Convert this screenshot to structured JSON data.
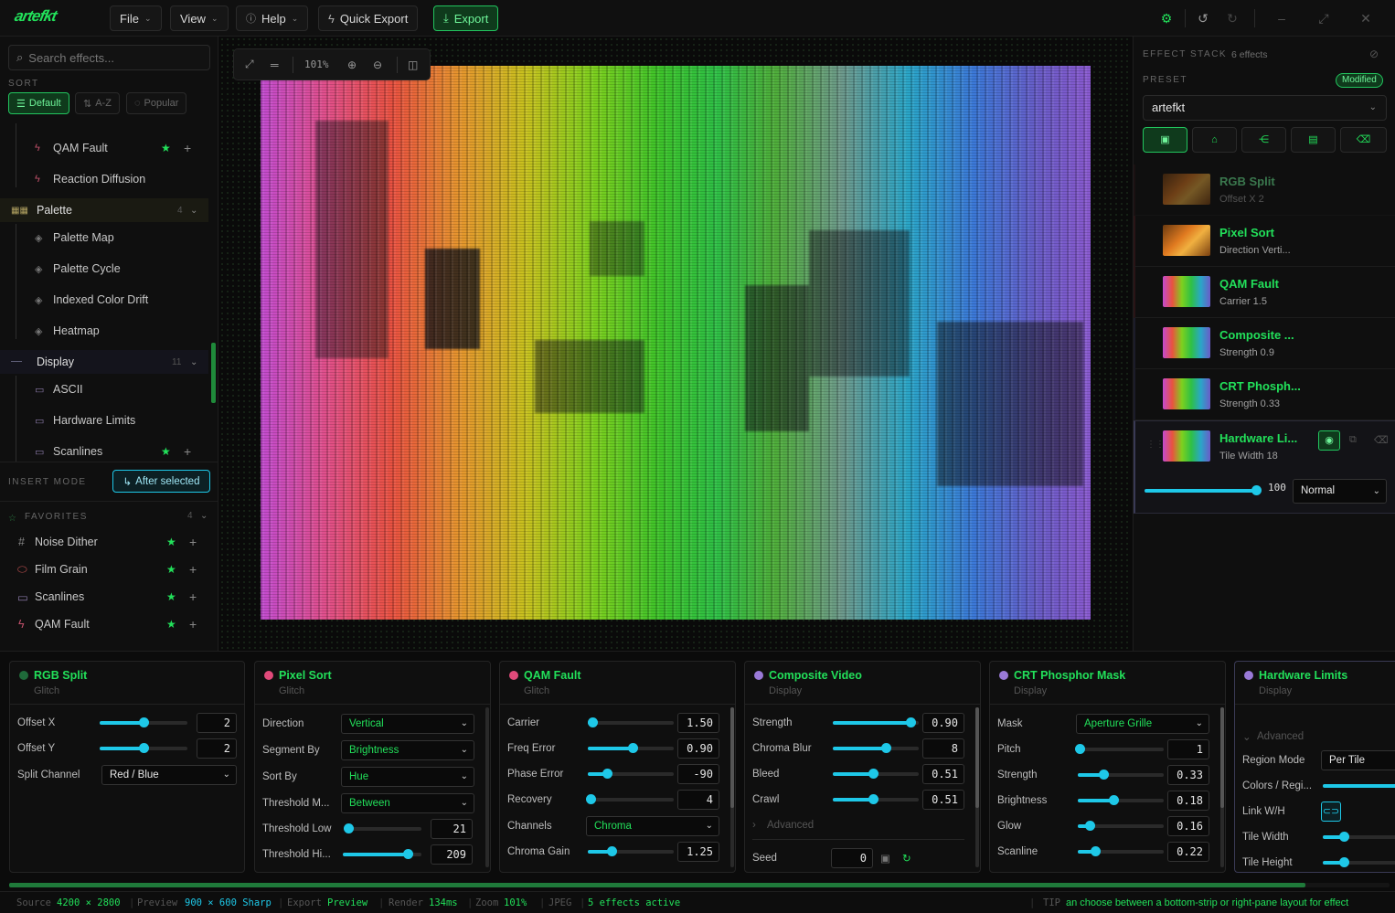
{
  "topbar": {
    "logo": "artefkt",
    "menus": [
      {
        "label": "File"
      },
      {
        "label": "View"
      },
      {
        "label": "Help"
      }
    ],
    "quick_export": "Quick Export",
    "export": "Export"
  },
  "left": {
    "search_placeholder": "Search effects...",
    "sort_label": "SORT",
    "sort_options": [
      "Default",
      "A-Z",
      "Popular"
    ],
    "tree": {
      "glitch_items": [
        "QAM Fault",
        "Reaction Diffusion"
      ],
      "palette": {
        "label": "Palette",
        "count": "4",
        "items": [
          "Palette Map",
          "Palette Cycle",
          "Indexed Color Drift",
          "Heatmap"
        ]
      },
      "display": {
        "label": "Display",
        "count": "11",
        "items": [
          "ASCII",
          "Hardware Limits",
          "Scanlines"
        ]
      }
    },
    "insert_mode_label": "INSERT MODE",
    "insert_mode_value": "After selected",
    "favorites": {
      "label": "FAVORITES",
      "count": "4",
      "items": [
        "Noise Dither",
        "Film Grain",
        "Scanlines",
        "QAM Fault"
      ]
    }
  },
  "canvas": {
    "zoom": "101%"
  },
  "right": {
    "title": "EFFECT STACK",
    "count": "6 effects",
    "preset_label": "PRESET",
    "modified": "Modified",
    "preset_value": "artefkt",
    "stack": [
      {
        "name": "RGB Split",
        "sub": "Offset X 2"
      },
      {
        "name": "Pixel Sort",
        "sub": "Direction Verti..."
      },
      {
        "name": "QAM Fault",
        "sub": "Carrier 1.5"
      },
      {
        "name": "Composite ...",
        "sub": "Strength 0.9"
      },
      {
        "name": "CRT Phosph...",
        "sub": "Strength 0.33"
      },
      {
        "name": "Hardware Li...",
        "sub": "Tile Width 18"
      }
    ],
    "opacity": "100",
    "blend": "Normal"
  },
  "panels": {
    "rgb": {
      "title": "RGB Split",
      "cat": "Glitch",
      "offset_x_label": "Offset X",
      "offset_x": "2",
      "offset_y_label": "Offset Y",
      "offset_y": "2",
      "split_label": "Split Channel",
      "split": "Red / Blue"
    },
    "pixel": {
      "title": "Pixel Sort",
      "cat": "Glitch",
      "direction_label": "Direction",
      "direction": "Vertical",
      "segment_label": "Segment By",
      "segment": "Brightness",
      "sort_label": "Sort By",
      "sort": "Hue",
      "thrmode_label": "Threshold M...",
      "thrmode": "Between",
      "thrlow_label": "Threshold Low",
      "thrlow": "21",
      "thrhi_label": "Threshold Hi...",
      "thrhi": "209"
    },
    "qam": {
      "title": "QAM Fault",
      "cat": "Glitch",
      "carrier_label": "Carrier",
      "carrier": "1.50",
      "freq_label": "Freq Error",
      "freq": "0.90",
      "phase_label": "Phase Error",
      "phase": "-90",
      "recovery_label": "Recovery",
      "recovery": "4",
      "channels_label": "Channels",
      "channels": "Chroma",
      "gain_label": "Chroma Gain",
      "gain": "1.25"
    },
    "comp": {
      "title": "Composite Video",
      "cat": "Display",
      "strength_label": "Strength",
      "strength": "0.90",
      "blur_label": "Chroma Blur",
      "blur": "8",
      "bleed_label": "Bleed",
      "bleed": "0.51",
      "crawl_label": "Crawl",
      "crawl": "0.51",
      "advanced": "Advanced",
      "seed_label": "Seed",
      "seed": "0"
    },
    "crt": {
      "title": "CRT Phosphor Mask",
      "cat": "Display",
      "mask_label": "Mask",
      "mask": "Aperture Grille",
      "pitch_label": "Pitch",
      "pitch": "1",
      "strength_label": "Strength",
      "strength": "0.33",
      "bright_label": "Brightness",
      "bright": "0.18",
      "glow_label": "Glow",
      "glow": "0.16",
      "scan_label": "Scanline",
      "scan": "0.22"
    },
    "hw": {
      "title": "Hardware Limits",
      "cat": "Display",
      "advanced": "Advanced",
      "region_label": "Region Mode",
      "region": "Per Tile",
      "colors_label": "Colors / Regi...",
      "link_label": "Link W/H",
      "tw_label": "Tile Width",
      "th_label": "Tile Height"
    }
  },
  "status": {
    "source_label": "Source",
    "source": "4200 × 2800",
    "preview_label": "Preview",
    "preview": "900 × 600 Sharp",
    "export_label": "Export",
    "export": "Preview",
    "render_label": "Render",
    "render": "134ms",
    "zoom_label": "Zoom",
    "zoom": "101%",
    "format": "JPEG",
    "effects": "5 effects active",
    "tip_label": "TIP",
    "tip": "an choose between a bottom-strip or right-pane layout for effect"
  }
}
